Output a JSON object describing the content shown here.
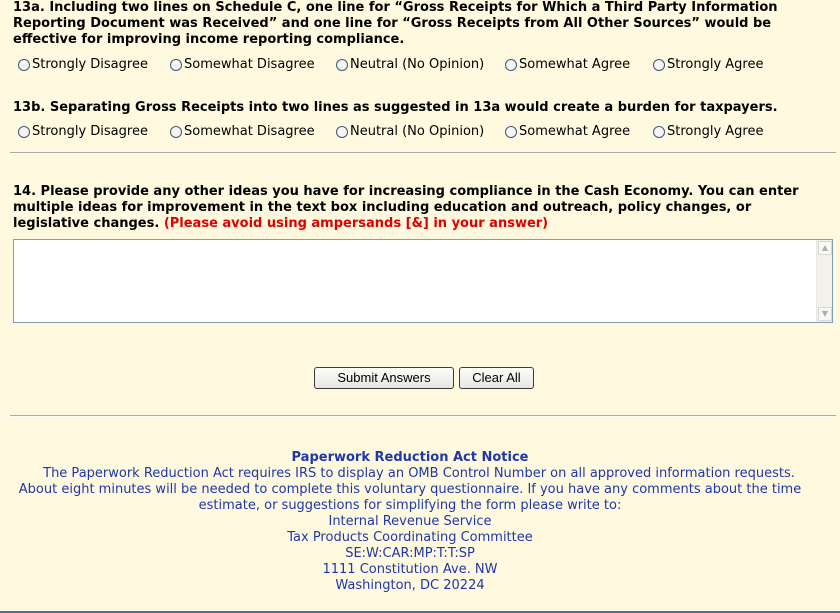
{
  "q13a": {
    "text": "13a. Including two lines on Schedule C, one line for “Gross Receipts for Which a Third Party Information Reporting Document was Received” and one line for “Gross Receipts from All Other Sources” would be effective for improving income reporting compliance."
  },
  "q13b": {
    "text": "13b. Separating Gross Receipts into two lines as suggested in 13a would create a burden for taxpayers."
  },
  "scale": [
    "Strongly Disagree",
    "Somewhat Disagree",
    "Neutral (No Opinion)",
    "Somewhat Agree",
    "Strongly Agree"
  ],
  "q14": {
    "text": "14. Please provide any other ideas you have for increasing compliance in the Cash Economy. You can enter multiple ideas for improvement in the text box including education and outreach, policy changes, or legislative changes.",
    "note": "(Please avoid using ampersands [&] in your answer)",
    "value": ""
  },
  "buttons": {
    "submit": "Submit Answers",
    "clear": "Clear All"
  },
  "notice": {
    "title": "Paperwork Reduction Act Notice",
    "line1": "The Paperwork Reduction Act requires IRS to display an OMB Control Number on all approved information requests.",
    "line2": "About eight minutes will be needed to complete this voluntary questionnaire. If you have any comments about the time",
    "line3": "estimate, or suggestions for simplifying the form please write to:",
    "org": "Internal Revenue Service",
    "committee": "Tax Products Coordinating Committee",
    "code": "SE:W:CAR:MP:T:T:SP",
    "street": "1111 Constitution Ave. NW",
    "city": "Washington, DC 20224"
  }
}
